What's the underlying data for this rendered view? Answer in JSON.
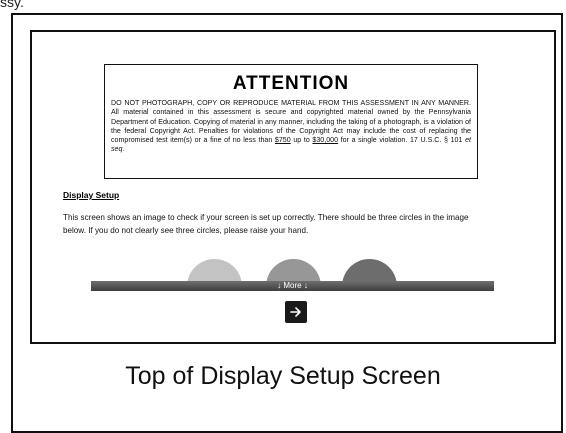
{
  "top_fragment": "ssy.",
  "attention": {
    "title": "ATTENTION",
    "p1": "DO NOT PHOTOGRAPH, COPY OR REPRODUCE MATERIAL FROM THIS ASSESSMENT IN ANY MANNER.  All material contained in this assessment is secure and copyrighted material owned by the Pennsylvania Department of Education.  Copying of material in any manner, including the taking of a photograph, is a violation of the federal Copyright Act.  Penalties for violations of the Copyright Act may include the cost of replacing the compromised test item(s) or a fine of no less than ",
    "amount_low": "$750",
    "p2": " up to ",
    "amount_high": "$30,000",
    "p3": " for a single violation. 17 U.S.C. § 101 ",
    "et_seq": "et seq",
    "p4": "."
  },
  "display_setup": {
    "heading": "Display Setup",
    "text": "This screen shows an image to check if your screen is set up correctly. There should be three circles in the image below. If you do not clearly see three circles, please raise your hand."
  },
  "circles": [
    {
      "name": "circle-light",
      "color": "#c3c3c3"
    },
    {
      "name": "circle-medium",
      "color": "#979797"
    },
    {
      "name": "circle-dark",
      "color": "#6d6d6d"
    }
  ],
  "more_bar": {
    "label": "↓ More ↓"
  },
  "next_button": {
    "icon": "arrow-right-icon"
  },
  "caption": "Top of Display Setup Screen"
}
